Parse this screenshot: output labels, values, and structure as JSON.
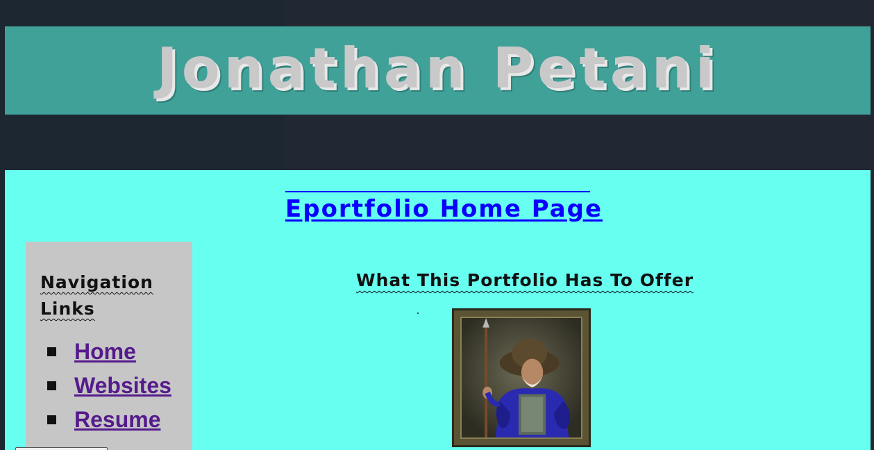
{
  "header": {
    "title": "Jonathan Petani"
  },
  "main": {
    "page_link": "Eportfolio Home Page",
    "offer_heading": "What This Portfolio Has To Offer"
  },
  "nav": {
    "heading": "Navigation Links",
    "items": [
      {
        "label": "Home"
      },
      {
        "label": "Websites"
      },
      {
        "label": "Resume"
      }
    ]
  },
  "colors": {
    "page_background": "#222833",
    "banner": "#40a198",
    "title_text": "#c9c9c9",
    "content_background": "#66fff0",
    "nav_background": "#c6c6c6",
    "page_link": "#0b00ff",
    "visited_link": "#551a8b"
  },
  "icons": {
    "bullet": "square-bullet-icon"
  }
}
